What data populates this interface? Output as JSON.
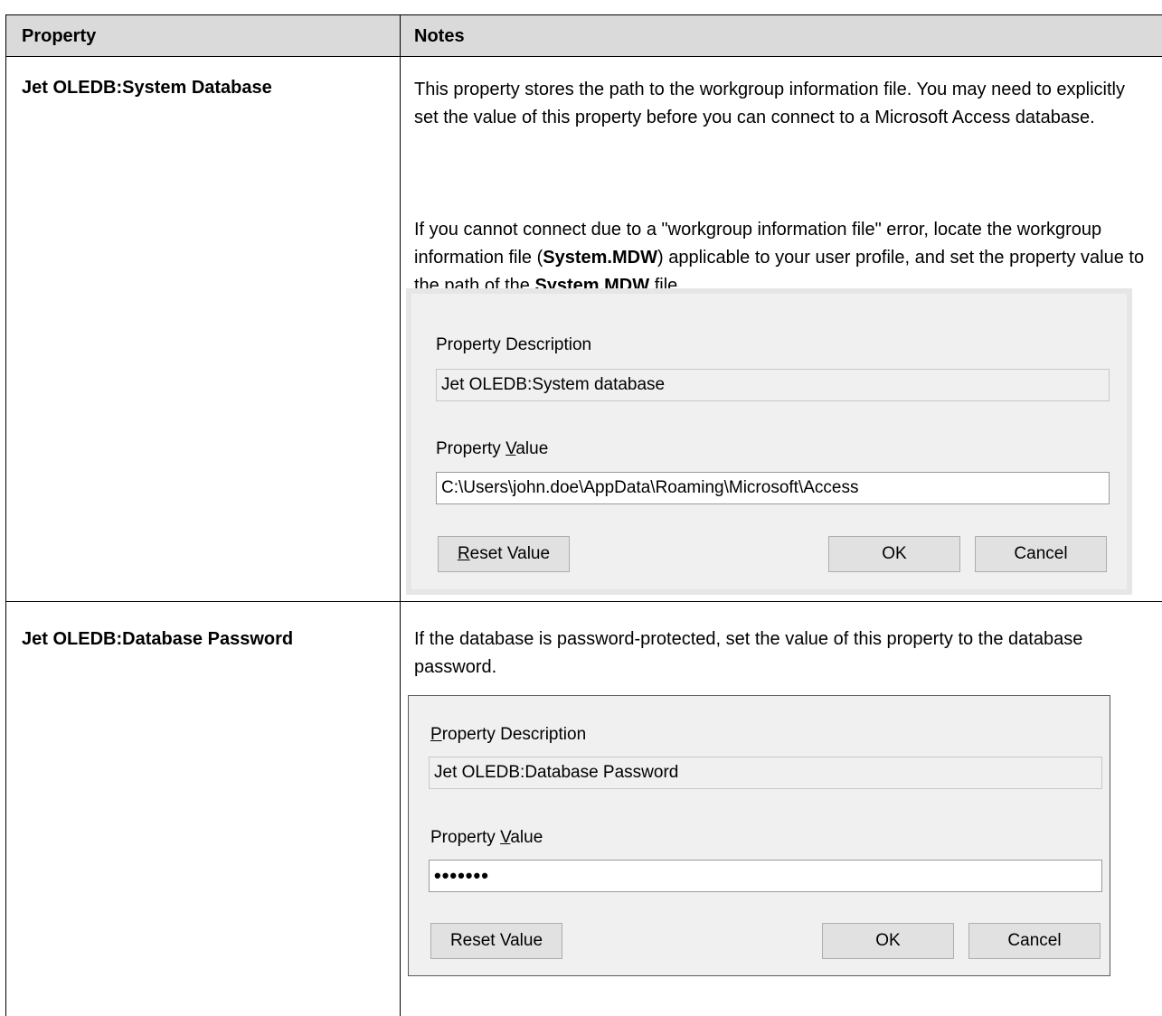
{
  "table": {
    "headers": [
      "Property",
      "Notes"
    ],
    "rows": [
      {
        "property": "Jet OLEDB:System Database",
        "notes": {
          "p1": "This property stores the path to the workgroup information file. You may need to explicitly set the value of this property before you can connect to a Microsoft Access database.",
          "p2_before": "If you cannot connect due to a \"workgroup information file\" error, locate the workgroup information file (",
          "p2_bold1": "System.MDW",
          "p2_mid": ") applicable to your user profile, and set the property value to the path of the ",
          "p2_bold2": "System.MDW",
          "p2_after": " file."
        },
        "dialog": {
          "description_label": "Property Description",
          "description_value": "Jet OLEDB:System database",
          "value_label_prefix": "Property ",
          "value_label_accel": "V",
          "value_label_suffix": "alue",
          "value": "C:\\Users\\john.doe\\AppData\\Roaming\\Microsoft\\Access",
          "reset_accel": "R",
          "reset_rest": "eset Value",
          "ok": "OK",
          "cancel": "Cancel"
        }
      },
      {
        "property": "Jet OLEDB:Database Password",
        "notes": {
          "p1": "If the database is password-protected, set the value of this property to the database password."
        },
        "dialog": {
          "description_label_accel": "P",
          "description_label_rest": "roperty Description",
          "description_value": "Jet OLEDB:Database Password",
          "value_label_prefix": "Property ",
          "value_label_accel": "V",
          "value_label_suffix": "alue",
          "masked_value": "•••••••",
          "reset": "Reset Value",
          "ok": "OK",
          "cancel": "Cancel"
        }
      }
    ]
  },
  "colors": {
    "header_bg": "#dadada",
    "dialog_bg": "#f0f0f0",
    "border": "#000000"
  }
}
